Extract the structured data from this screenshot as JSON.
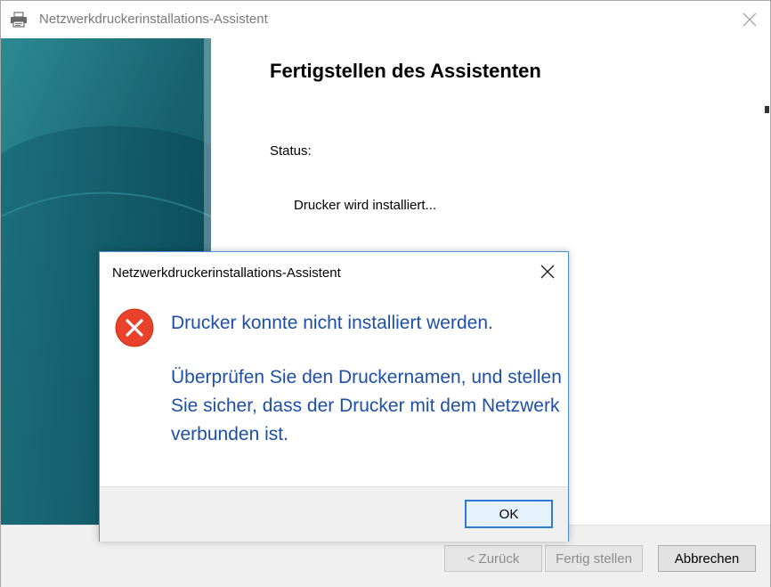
{
  "wizard": {
    "title": "Netzwerkdruckerinstallations-Assistent",
    "heading": "Fertigstellen des Assistenten",
    "status_label": "Status:",
    "status_text": "Drucker wird installiert...",
    "buttons": {
      "back": "< Zurück",
      "finish": "Fertig stellen",
      "cancel": "Abbrechen"
    }
  },
  "dialog": {
    "title": "Netzwerkdruckerinstallations-Assistent",
    "message": "Drucker konnte nicht installiert werden.",
    "detail": "Überprüfen Sie den Druckernamen, und stellen Sie sicher, dass der Drucker mit dem Netzwerk verbunden ist.",
    "ok_label": "OK",
    "icon": "error-icon"
  },
  "colors": {
    "message_text": "#1e4fa8",
    "error_red": "#e8412c",
    "focus_blue": "#2b7bd6",
    "banner_teal": "#1d6a7a"
  }
}
